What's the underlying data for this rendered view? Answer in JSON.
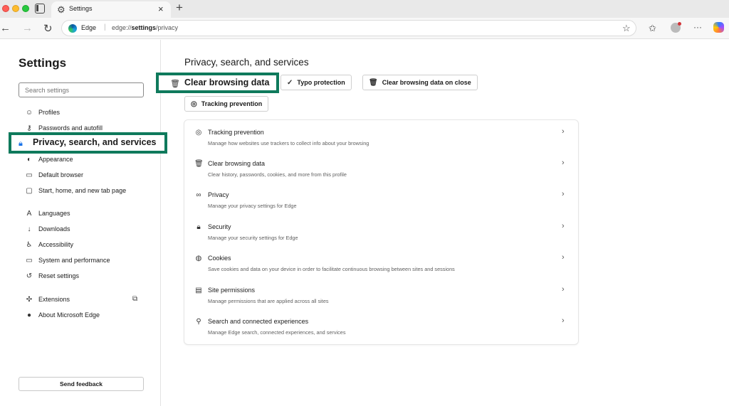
{
  "browser": {
    "tab_title": "Settings",
    "url_site": "Edge",
    "url_prefix": "edge://",
    "url_bold": "settings",
    "url_suffix": "/privacy",
    "icons": [
      "tab-actions-icon",
      "gear-icon",
      "close-icon",
      "new-tab-icon",
      "back-icon",
      "forward-icon",
      "refresh-icon",
      "favorite-star-icon",
      "favorites-icon",
      "profile-icon",
      "more-icon",
      "copilot-icon"
    ]
  },
  "sidebar": {
    "title": "Settings",
    "search_placeholder": "Search settings",
    "items": [
      {
        "label": "Profiles",
        "icon": "profile-icon"
      },
      {
        "label": "Passwords and autofill",
        "icon": "key-icon"
      },
      {
        "label": "Privacy, search, and services",
        "icon": "lock-icon"
      },
      {
        "label": "Appearance",
        "icon": "appearance-icon"
      },
      {
        "label": "Default browser",
        "icon": "browser-icon"
      },
      {
        "label": "Start, home, and new tab page",
        "icon": "home-icon"
      },
      {
        "label": "Languages",
        "icon": "languages-icon"
      },
      {
        "label": "Downloads",
        "icon": "download-icon"
      },
      {
        "label": "Accessibility",
        "icon": "accessibility-icon"
      },
      {
        "label": "System and performance",
        "icon": "laptop-icon"
      },
      {
        "label": "Reset settings",
        "icon": "reset-icon"
      },
      {
        "label": "Extensions",
        "icon": "puzzle-icon"
      },
      {
        "label": "About Microsoft Edge",
        "icon": "edge-icon"
      }
    ],
    "feedback_label": "Send feedback"
  },
  "main": {
    "title": "Privacy, search, and services",
    "chips": [
      {
        "label": "Clear browsing data",
        "icon": "trash-icon"
      },
      {
        "label": "Typo protection",
        "icon": "spellcheck-icon"
      },
      {
        "label": "Clear browsing data on close",
        "icon": "trash-clock-icon"
      },
      {
        "label": "Tracking prevention",
        "icon": "tracking-icon"
      }
    ],
    "rows": [
      {
        "title": "Tracking prevention",
        "desc": "Manage how websites use trackers to collect info about your browsing",
        "icon": "tracking-icon"
      },
      {
        "title": "Clear browsing data",
        "desc": "Clear history, passwords, cookies, and more from this profile",
        "icon": "trash-icon"
      },
      {
        "title": "Privacy",
        "desc": "Manage your privacy settings for Edge",
        "icon": "privacy-glasses-icon"
      },
      {
        "title": "Security",
        "desc": "Manage your security settings for Edge",
        "icon": "lock-icon"
      },
      {
        "title": "Cookies",
        "desc": "Save cookies and data on your device in order to facilitate continuous browsing between sites and sessions",
        "icon": "cookie-icon"
      },
      {
        "title": "Site permissions",
        "desc": "Manage permissions that are applied across all sites",
        "icon": "site-permissions-icon"
      },
      {
        "title": "Search and connected experiences",
        "desc": "Manage Edge search, connected experiences, and services",
        "icon": "search-icon"
      }
    ]
  },
  "colors": {
    "highlight_border": "#0f7a5c",
    "accent": "#1a73e8"
  }
}
